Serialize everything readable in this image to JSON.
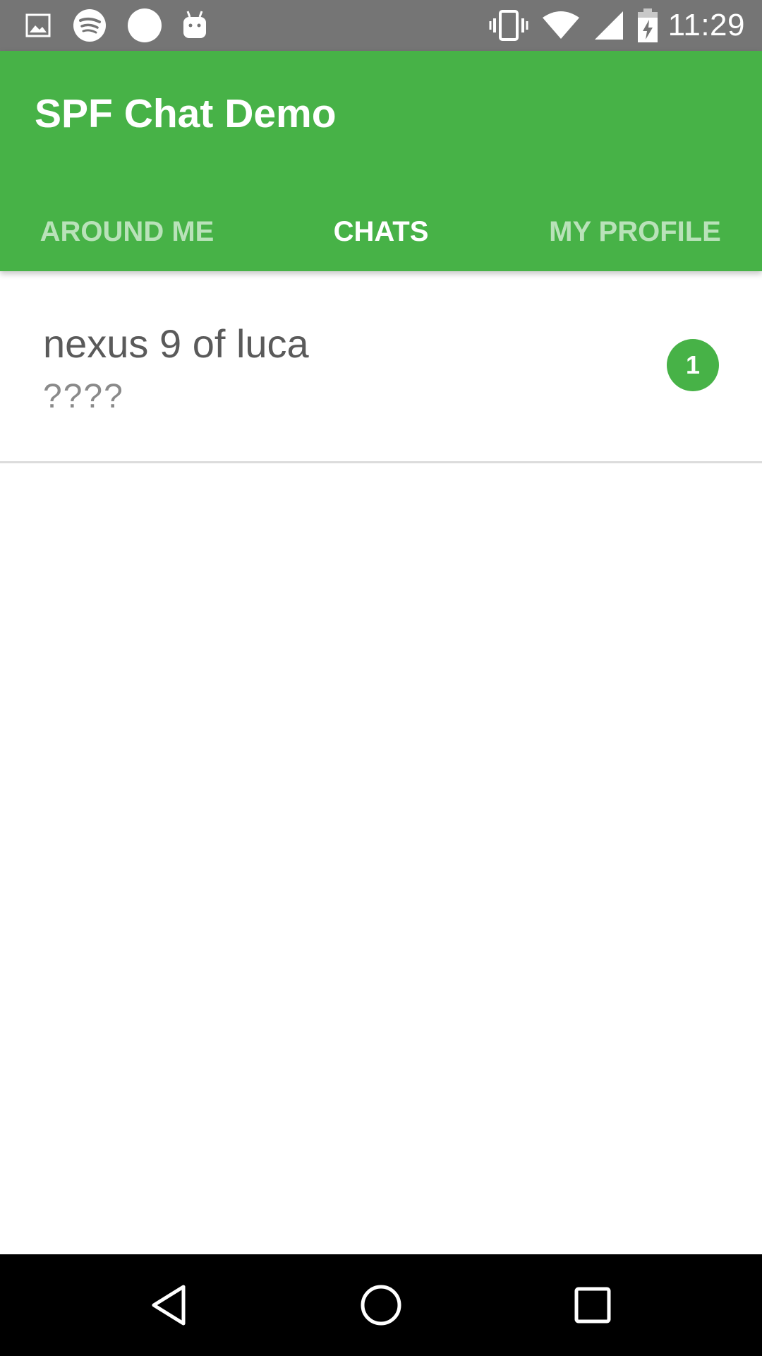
{
  "status_bar": {
    "time": "11:29",
    "left_icons": [
      "image-notification-icon",
      "spotify-icon",
      "circle-notification-icon",
      "android-notification-icon"
    ],
    "right_icons": [
      "vibrate-icon",
      "wifi-icon",
      "cell-signal-icon",
      "battery-charging-icon"
    ]
  },
  "app_bar": {
    "title": "SPF Chat Demo",
    "color": "#47b247",
    "tabs": [
      {
        "label": "AROUND ME",
        "active": false
      },
      {
        "label": "CHATS",
        "active": true
      },
      {
        "label": "MY PROFILE",
        "active": false
      }
    ]
  },
  "chats": [
    {
      "name": "nexus 9 of luca",
      "preview": "????",
      "unread": "1"
    }
  ],
  "nav_bar": {
    "buttons": [
      "back-icon",
      "home-icon",
      "recents-icon"
    ]
  }
}
